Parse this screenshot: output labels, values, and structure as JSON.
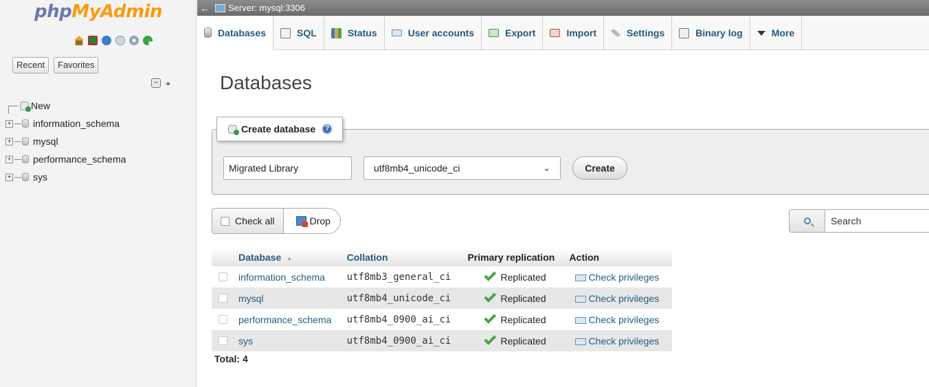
{
  "nav": {
    "logo_php": "php",
    "logo_myadmin": "MyAdmin",
    "quick_icons": [
      "home-icon",
      "logout-icon",
      "docs-icon",
      "sql-docs-icon",
      "settings-icon",
      "reload-icon"
    ],
    "recent_label": "Recent",
    "favorites_label": "Favorites",
    "collapse_label": "−",
    "tree": {
      "new_label": "New",
      "databases": [
        "information_schema",
        "mysql",
        "performance_schema",
        "sys"
      ]
    }
  },
  "header": {
    "back_arrow": "←",
    "server_label": "Server: mysql:3306"
  },
  "menu": {
    "tabs": [
      {
        "label": "Databases",
        "icon": "databases-icon",
        "active": true
      },
      {
        "label": "SQL",
        "icon": "sql-icon"
      },
      {
        "label": "Status",
        "icon": "status-icon"
      },
      {
        "label": "User accounts",
        "icon": "user-accounts-icon"
      },
      {
        "label": "Export",
        "icon": "export-icon"
      },
      {
        "label": "Import",
        "icon": "import-icon"
      },
      {
        "label": "Settings",
        "icon": "wrench-icon"
      },
      {
        "label": "Binary log",
        "icon": "binary-log-icon"
      },
      {
        "label": "More",
        "icon": "caret-down-icon"
      }
    ]
  },
  "main": {
    "title": "Databases",
    "create": {
      "legend": "Create database",
      "db_name_value": "Migrated Library",
      "collation_value": "utf8mb4_unicode_ci",
      "chevron": "⌄",
      "create_label": "Create"
    },
    "bulk": {
      "check_all_label": "Check all",
      "drop_label": "Drop"
    },
    "search": {
      "placeholder": "Search"
    },
    "table": {
      "headers": {
        "database": "Database",
        "collation": "Collation",
        "replication": "Primary replication",
        "action": "Action"
      },
      "sort_arrow": "▲",
      "rows": [
        {
          "name": "information_schema",
          "collation": "utf8mb3_general_ci",
          "replication": "Replicated",
          "action": "Check privileges"
        },
        {
          "name": "mysql",
          "collation": "utf8mb4_unicode_ci",
          "replication": "Replicated",
          "action": "Check privileges"
        },
        {
          "name": "performance_schema",
          "collation": "utf8mb4_0900_ai_ci",
          "replication": "Replicated",
          "action": "Check privileges"
        },
        {
          "name": "sys",
          "collation": "utf8mb4_0900_ai_ci",
          "replication": "Replicated",
          "action": "Check privileges"
        }
      ]
    },
    "total": "Total: 4"
  },
  "colors": {
    "logo_php": "#6c78af",
    "logo_myadmin": "#f89c0e",
    "link": "#235a81",
    "server_bar": "#7a7a7a",
    "success": "#4aa342"
  }
}
